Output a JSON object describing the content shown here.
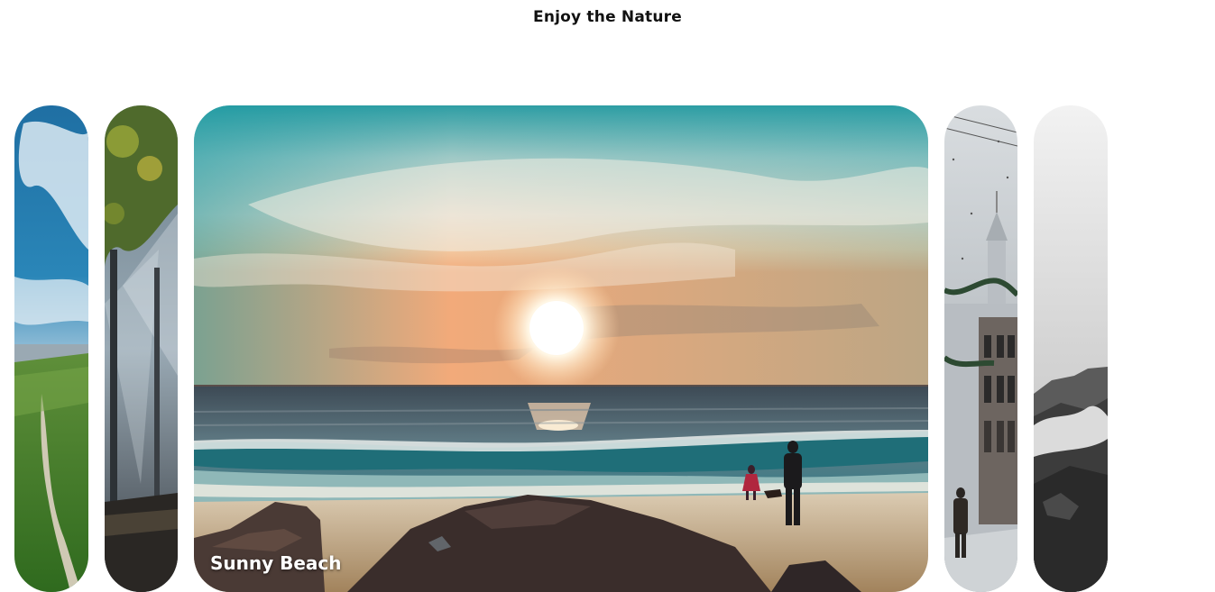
{
  "page": {
    "title": "Enjoy the Nature"
  },
  "panels": [
    {
      "label": "",
      "scene": "mountain-meadow-path",
      "active": false
    },
    {
      "label": "",
      "scene": "misty-forest-sunrays",
      "active": false
    },
    {
      "label": "Sunny Beach",
      "scene": "sunset-beach",
      "active": true
    },
    {
      "label": "",
      "scene": "snowy-city-street",
      "active": false
    },
    {
      "label": "",
      "scene": "foggy-mountains-bw",
      "active": false
    }
  ],
  "colors": {
    "background": "#ffffff",
    "title": "#111111",
    "label": "#ffffff"
  }
}
